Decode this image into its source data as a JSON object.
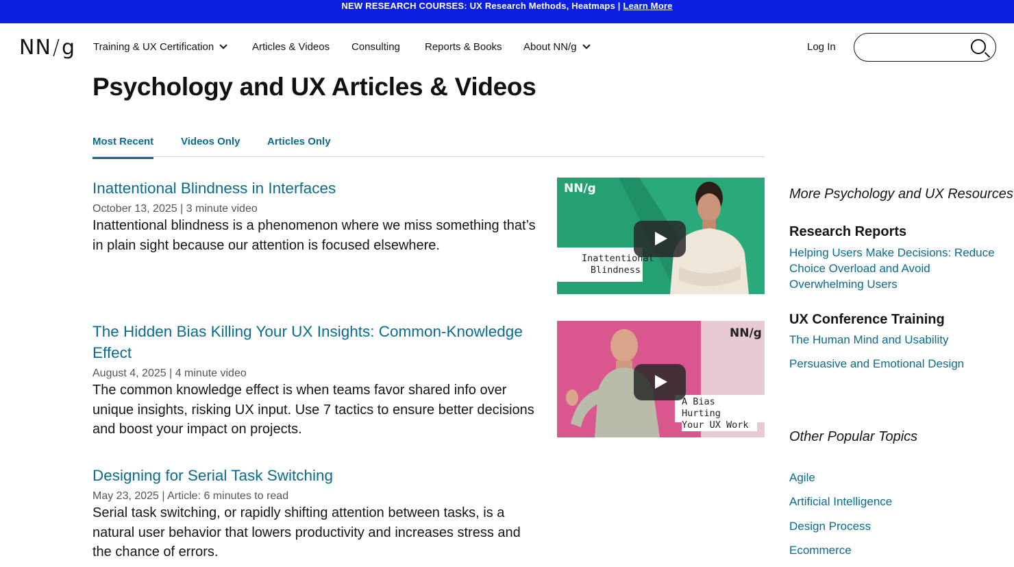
{
  "banner": {
    "text": "NEW RESEARCH COURSES: UX Research Methods, Heatmaps | ",
    "link": "Learn More"
  },
  "logo": {
    "left": "NN",
    "slash": "/",
    "right": "g"
  },
  "nav": {
    "items": [
      {
        "label": "Training & UX Certification",
        "dropdown": true
      },
      {
        "label": "Articles & Videos",
        "dropdown": false
      },
      {
        "label": "Consulting",
        "dropdown": false
      },
      {
        "label": "Reports & Books",
        "dropdown": false
      },
      {
        "label": "About NN/g",
        "dropdown": true
      }
    ],
    "login": "Log In",
    "search_placeholder": ""
  },
  "page": {
    "title": "Psychology and UX Articles & Videos"
  },
  "tabs": [
    "Most Recent",
    "Videos Only",
    "Articles Only"
  ],
  "articles": [
    {
      "title": "Inattentional Blindness in Interfaces",
      "meta": "October 13, 2025 | 3 minute video",
      "desc": "Inattentional blindness is a phenomenon where we miss something that’s in plain sight because our attention is focused elsewhere."
    },
    {
      "title": "The Hidden Bias Killing Your UX Insights: Common-Knowledge Effect",
      "meta": "August 4, 2025 | 4 minute video",
      "desc": "The common knowledge effect is when teams favor shared info over unique insights, risking UX input. Use 7 tactics to ensure better decisions and boost your impact on projects."
    },
    {
      "title": "Designing for Serial Task Switching",
      "meta": "May 23, 2025 | Article: 6 minutes to read",
      "desc": "Serial task switching, or rapidly shifting attention between tasks, is a natural user behavior that lowers productivity and increases stress and the chance of errors."
    }
  ],
  "thumbnails": [
    {
      "brand": "NN/g",
      "caption_line1": "Inattentional",
      "caption_line2": "Blindness",
      "colors": {
        "dark": "#1f9a6c",
        "light": "#3dbb8a"
      }
    },
    {
      "brand": "NN/g",
      "caption_line1": "A Bias Hurting",
      "caption_line2": "Your UX Work",
      "colors": {
        "pink": "#d9578e",
        "gray": "#e3c6cf"
      }
    }
  ],
  "sidebar": {
    "resources_heading": "More Psychology and UX Resources",
    "reports_heading": "Research Reports",
    "report_link": "Helping Users Make Decisions: Reduce Choice Overload and Avoid Overwhelming Users",
    "training_heading": "UX Conference Training",
    "training_links": [
      "The Human Mind and Usability",
      "Persuasive and Emotional Design"
    ],
    "topics_heading": "Other Popular Topics",
    "topics": [
      "Agile",
      "Artificial Intelligence",
      "Design Process",
      "Ecommerce"
    ]
  },
  "colors": {
    "banner": "#0c1ee0",
    "link": "#0a6b8c"
  }
}
